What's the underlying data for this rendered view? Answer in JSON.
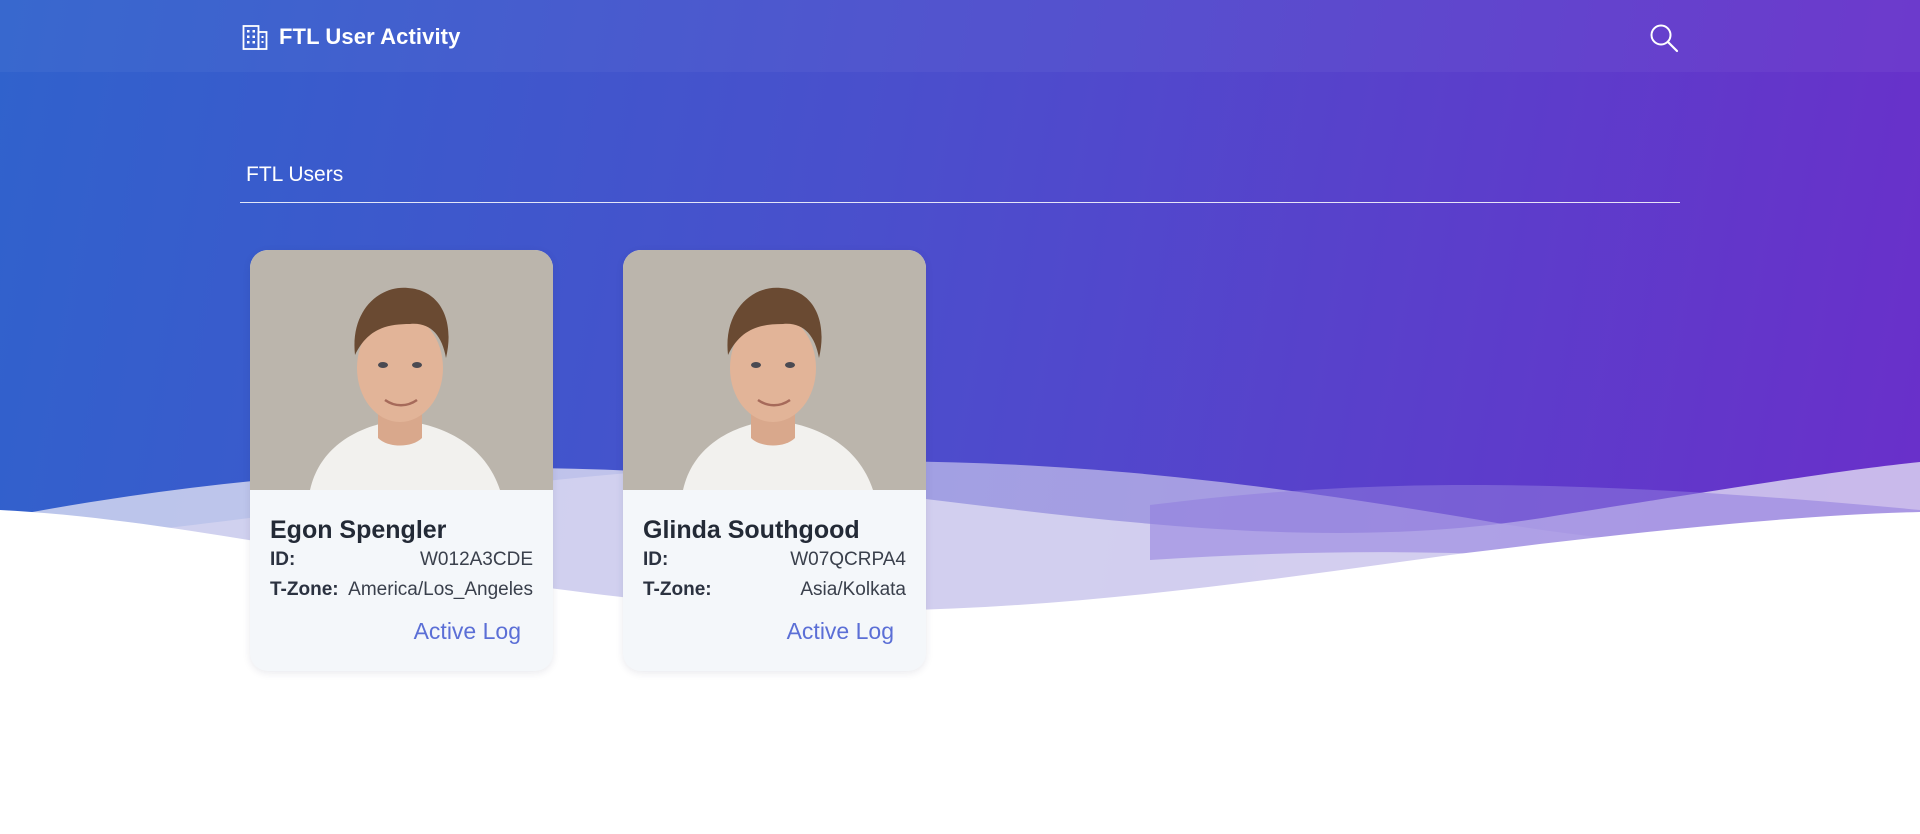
{
  "header": {
    "title": "FTL User Activity",
    "brand_icon": "building-icon",
    "search_icon": "search-icon"
  },
  "section": {
    "title": "FTL Users"
  },
  "users": [
    {
      "name": "Egon Spengler",
      "id_label": "ID:",
      "id": "W012A3CDE",
      "tz_label": "T-Zone:",
      "tz": "America/Los_Angeles",
      "action": "Active Log"
    },
    {
      "name": "Glinda Southgood",
      "id_label": "ID:",
      "id": "W07QCRPA4",
      "tz_label": "T-Zone:",
      "tz": "Asia/Kolkata",
      "action": "Active Log"
    }
  ],
  "colors": {
    "gradient_start": "#3062cc",
    "gradient_end": "#6a2fca",
    "card_bg": "#f4f7fa",
    "link": "#5b6fd6"
  }
}
